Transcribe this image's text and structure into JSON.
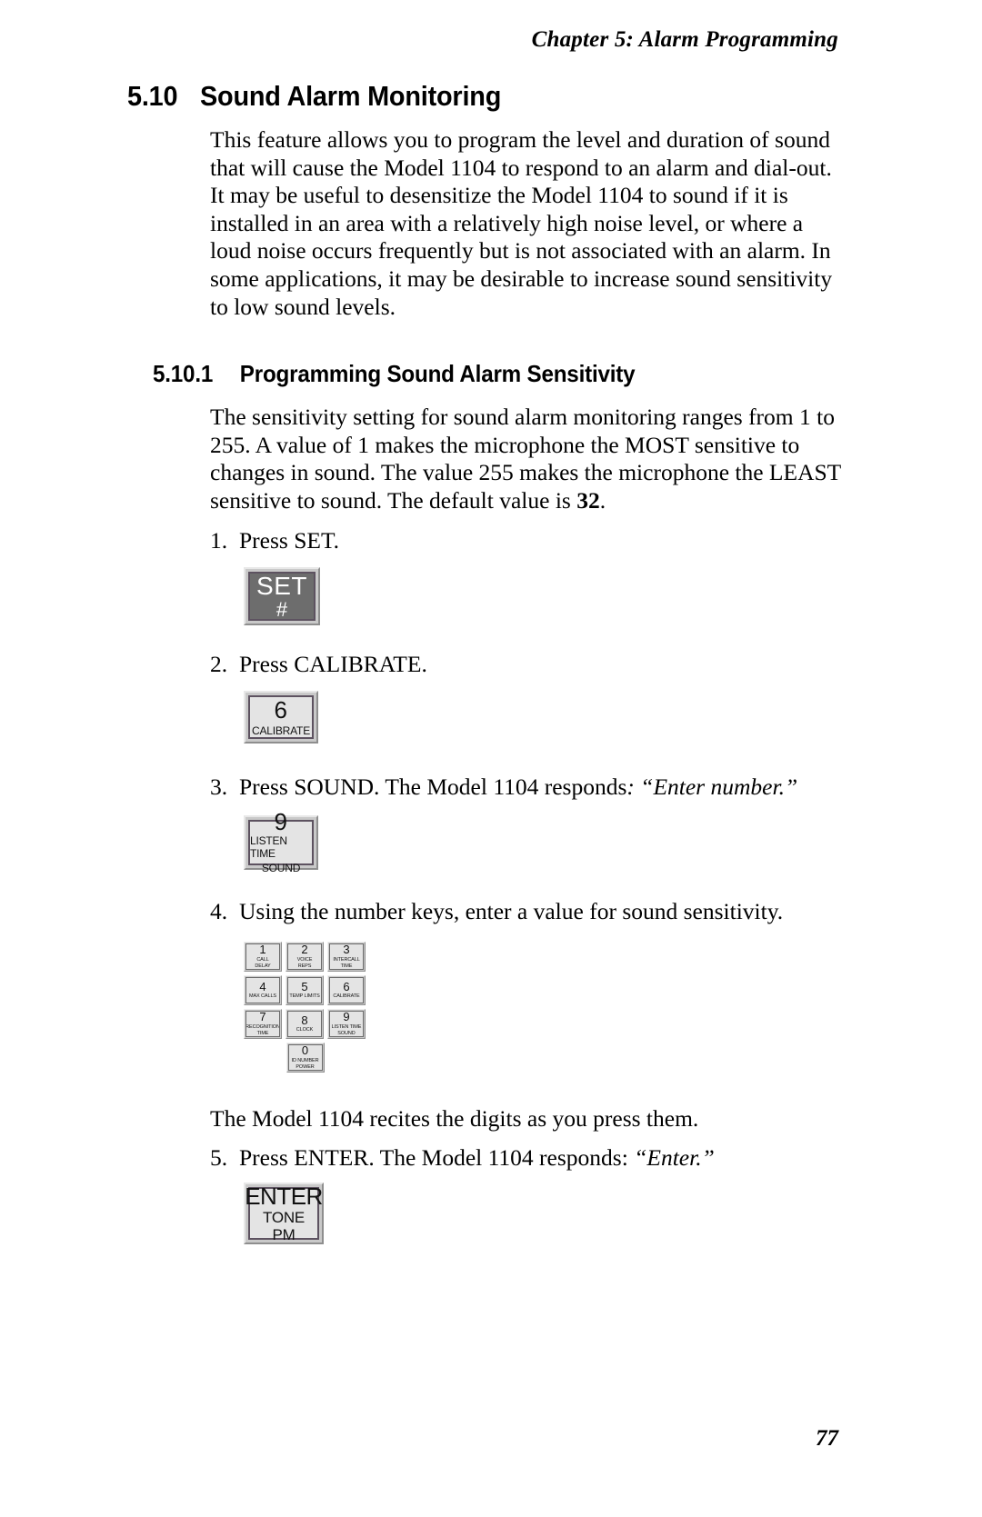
{
  "header": {
    "running_head": "Chapter 5: Alarm Programming"
  },
  "section": {
    "number": "5.10",
    "title": "Sound Alarm Monitoring",
    "intro_paragraph": "This feature allows you to program the level and duration of sound that will cause the Model 1104 to respond to an alarm and dial-out. It may be useful to desensitize the Model 1104 to sound if it is installed in an area with a relatively high noise level, or where a loud noise occurs frequently but is not associated with an alarm. In some applications, it may be desirable to increase sound sensitivity to low sound levels."
  },
  "subsection": {
    "number": "5.10.1",
    "title": "Programming Sound Alarm Sensitivity",
    "paragraph_part1": "The sensitivity setting for sound alarm monitoring ranges from 1 to 255. A value of 1 makes the microphone the MOST sensitive to changes in sound. The value 255 makes the microphone the LEAST sensitive to sound. The default value is ",
    "paragraph_bold_value": "32",
    "paragraph_part2": "."
  },
  "steps": [
    {
      "marker": "1.",
      "text": "Press SET."
    },
    {
      "marker": "2.",
      "text": "Press CALIBRATE."
    },
    {
      "marker": "3.",
      "text_plain": "Press SOUND. The Model 1104 responds",
      "text_italic": ": “Enter number.”"
    },
    {
      "marker": "4.",
      "text": "Using the number keys, enter a value for sound sensitivity."
    },
    {
      "marker": "5.",
      "text_plain": "Press ENTER.  The Model 1104 responds: ",
      "text_italic": "“Enter.”"
    }
  ],
  "keys": {
    "set": {
      "primary": "SET",
      "secondary": "#"
    },
    "calibrate": {
      "primary": "6",
      "secondary": "CALIBRATE"
    },
    "sound": {
      "primary": "9",
      "secondary": "LISTEN TIME",
      "tertiary": "SOUND"
    },
    "enter": {
      "primary": "ENTER",
      "secondary": "TONE",
      "tertiary": "PM"
    }
  },
  "keypad": {
    "rows": [
      [
        {
          "digit": "1",
          "label": "CALL\nDELAY"
        },
        {
          "digit": "2",
          "label": "VOICE\nREPS"
        },
        {
          "digit": "3",
          "label": "INTERCALL\nTIME"
        }
      ],
      [
        {
          "digit": "4",
          "label": "MAX CALLS"
        },
        {
          "digit": "5",
          "label": "TEMP LIMITS"
        },
        {
          "digit": "6",
          "label": "CALIBRATE"
        }
      ],
      [
        {
          "digit": "7",
          "label": "RECOGNITION\nTIME"
        },
        {
          "digit": "8",
          "label": "CLOCK"
        },
        {
          "digit": "9",
          "label": "LISTEN TIME\nSOUND"
        }
      ]
    ],
    "zero": {
      "digit": "0",
      "label": "ID NUMBER\nPOWER"
    }
  },
  "body": {
    "recite_paragraph": "The Model 1104 recites the digits as you press them."
  },
  "footer": {
    "page_number": "77"
  }
}
